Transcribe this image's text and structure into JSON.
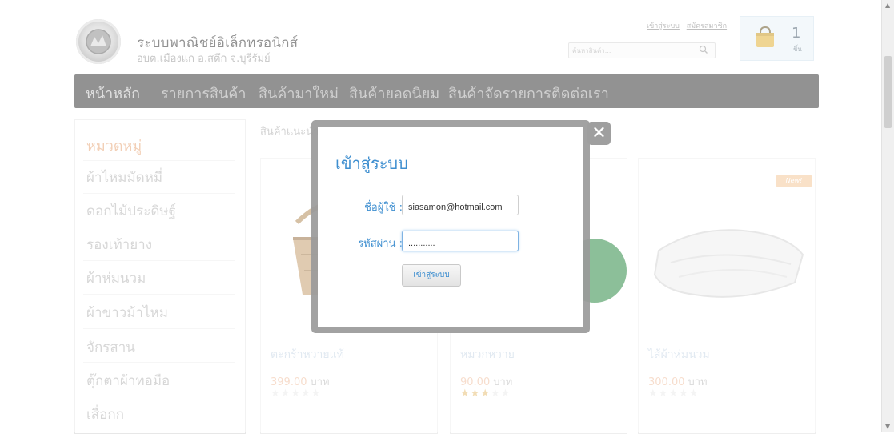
{
  "header": {
    "site_title": "ระบบพาณิชย์อิเล็กทรอนิกส์",
    "site_subtitle": "อบต.เมืองแก อ.สตึก จ.บุรีรัมย์",
    "login_link": "เข้าสู่ระบบ",
    "register_link": "สมัครสมาชิก",
    "search_placeholder": "ค้นหาสินค้า...",
    "cart_count": "1",
    "cart_unit": "ชิ้น"
  },
  "nav": {
    "items": [
      "หน้าหลัก",
      "รายการสินค้า",
      "สินค้ามาใหม่",
      "สินค้ายอดนิยม",
      "สินค้าจัดรายการ",
      "ติดต่อเรา"
    ]
  },
  "sidebar": {
    "title": "หมวดหมู่",
    "items": [
      "ผ้าไหมมัดหมี่",
      "ดอกไม้ประดิษฐ์",
      "รองเท้ายาง",
      "ผ้าห่มนวม",
      "ผ้าขาวม้าไหม",
      "จักรสาน",
      "ตุ๊กตาผ้าทอมือ",
      "เสื่อกก"
    ]
  },
  "main": {
    "section_label": "สินค้าแนะนำ",
    "products": [
      {
        "name": "ตะกร้าหวายแท้",
        "price": "399.00",
        "currency": "บาท",
        "rating": 0
      },
      {
        "name": "หมวกหวาย",
        "price": "90.00",
        "currency": "บาท",
        "rating": 3
      },
      {
        "name": "ไส้ผ้าห่มนวม",
        "price": "300.00",
        "currency": "บาท",
        "rating": 0,
        "badge": "New!"
      }
    ]
  },
  "login_modal": {
    "title": "เข้าสู่ระบบ",
    "username_label": "ชื่อผู้ใช้ :",
    "username_value": "siasamon@hotmail.com",
    "password_label": "รหัสผ่าน :",
    "password_value": "...........",
    "submit_label": "เข้าสู่ระบบ",
    "close_symbol": "✕"
  },
  "colors": {
    "accent_blue": "#3f8fd0",
    "nav_bg": "#3a3a3a",
    "category_title": "#e8a87a",
    "star_on": "#e7c27a"
  },
  "icons": [
    "search-icon",
    "shopping-bag-icon",
    "close-icon",
    "star-icon"
  ]
}
